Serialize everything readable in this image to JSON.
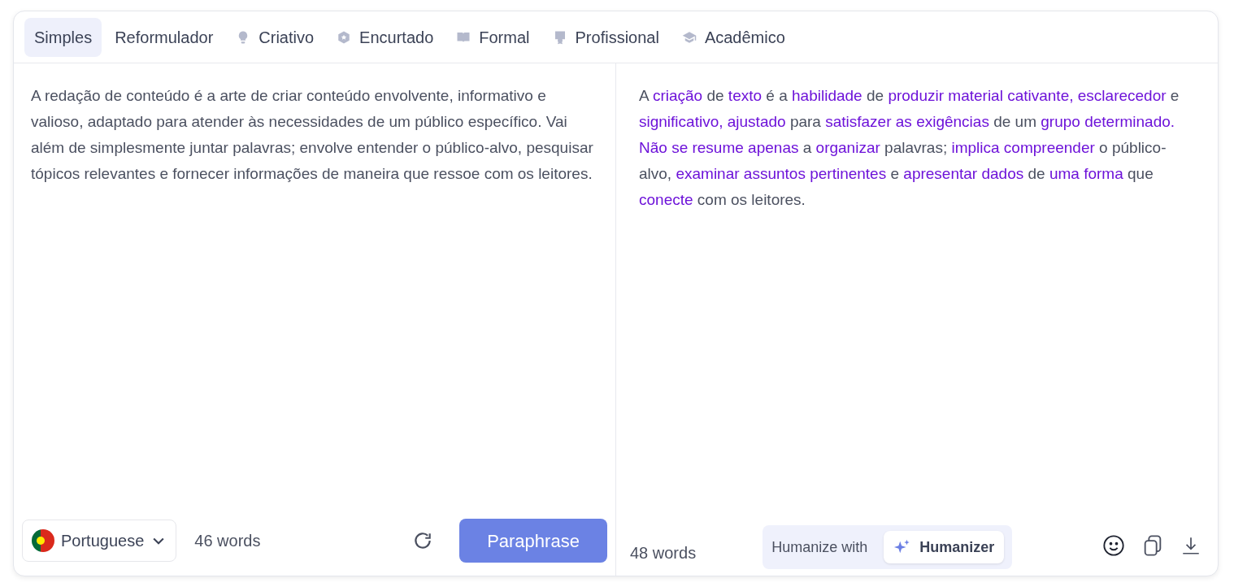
{
  "tabs": [
    {
      "label": "Simples",
      "selected": true,
      "kind": "plain"
    },
    {
      "label": "Reformulador",
      "selected": false,
      "kind": "plain"
    },
    {
      "label": "Criativo",
      "selected": false,
      "kind": "bulb"
    },
    {
      "label": "Encurtado",
      "selected": false,
      "kind": "hexagon"
    },
    {
      "label": "Formal",
      "selected": false,
      "kind": "book"
    },
    {
      "label": "Profissional",
      "selected": false,
      "kind": "certificate"
    },
    {
      "label": "Acadêmico",
      "selected": false,
      "kind": "cap"
    }
  ],
  "input": {
    "text": "A redação de conteúdo é a arte de criar conteúdo envolvente, informativo e valioso, adaptado para atender às necessidades de um público específico. Vai além de simplesmente juntar palavras; envolve entender o público-alvo, pesquisar tópicos relevantes e fornecer informações de maneira que ressoe com os leitores.",
    "language": "Portuguese",
    "word_count": "46 words",
    "button": "Paraphrase"
  },
  "output": {
    "segments": [
      {
        "text": "A ",
        "changed": false
      },
      {
        "text": "criação",
        "changed": true
      },
      {
        "text": " de ",
        "changed": false
      },
      {
        "text": "texto",
        "changed": true
      },
      {
        "text": " é a ",
        "changed": false
      },
      {
        "text": "habilidade",
        "changed": true
      },
      {
        "text": " de ",
        "changed": false
      },
      {
        "text": "produzir material cativante, esclarecedor",
        "changed": true
      },
      {
        "text": " e ",
        "changed": false
      },
      {
        "text": "significativo, ajustado",
        "changed": true
      },
      {
        "text": " para ",
        "changed": false
      },
      {
        "text": "satisfazer as exigências",
        "changed": true
      },
      {
        "text": " de um ",
        "changed": false
      },
      {
        "text": "grupo determinado. Não se resume apenas",
        "changed": true
      },
      {
        "text": " a ",
        "changed": false
      },
      {
        "text": "organizar",
        "changed": true
      },
      {
        "text": " palavras; ",
        "changed": false
      },
      {
        "text": "implica compreender",
        "changed": true
      },
      {
        "text": " o público-alvo, ",
        "changed": false
      },
      {
        "text": "examinar assuntos pertinentes",
        "changed": true
      },
      {
        "text": " e ",
        "changed": false
      },
      {
        "text": "apresentar dados",
        "changed": true
      },
      {
        "text": " de ",
        "changed": false
      },
      {
        "text": "uma forma",
        "changed": true
      },
      {
        "text": " que ",
        "changed": false
      },
      {
        "text": "conecte",
        "changed": true
      },
      {
        "text": " com os leitores.",
        "changed": false
      }
    ],
    "word_count": "48 words",
    "humanize_label": "Humanize with",
    "humanize_button": "Humanizer"
  }
}
